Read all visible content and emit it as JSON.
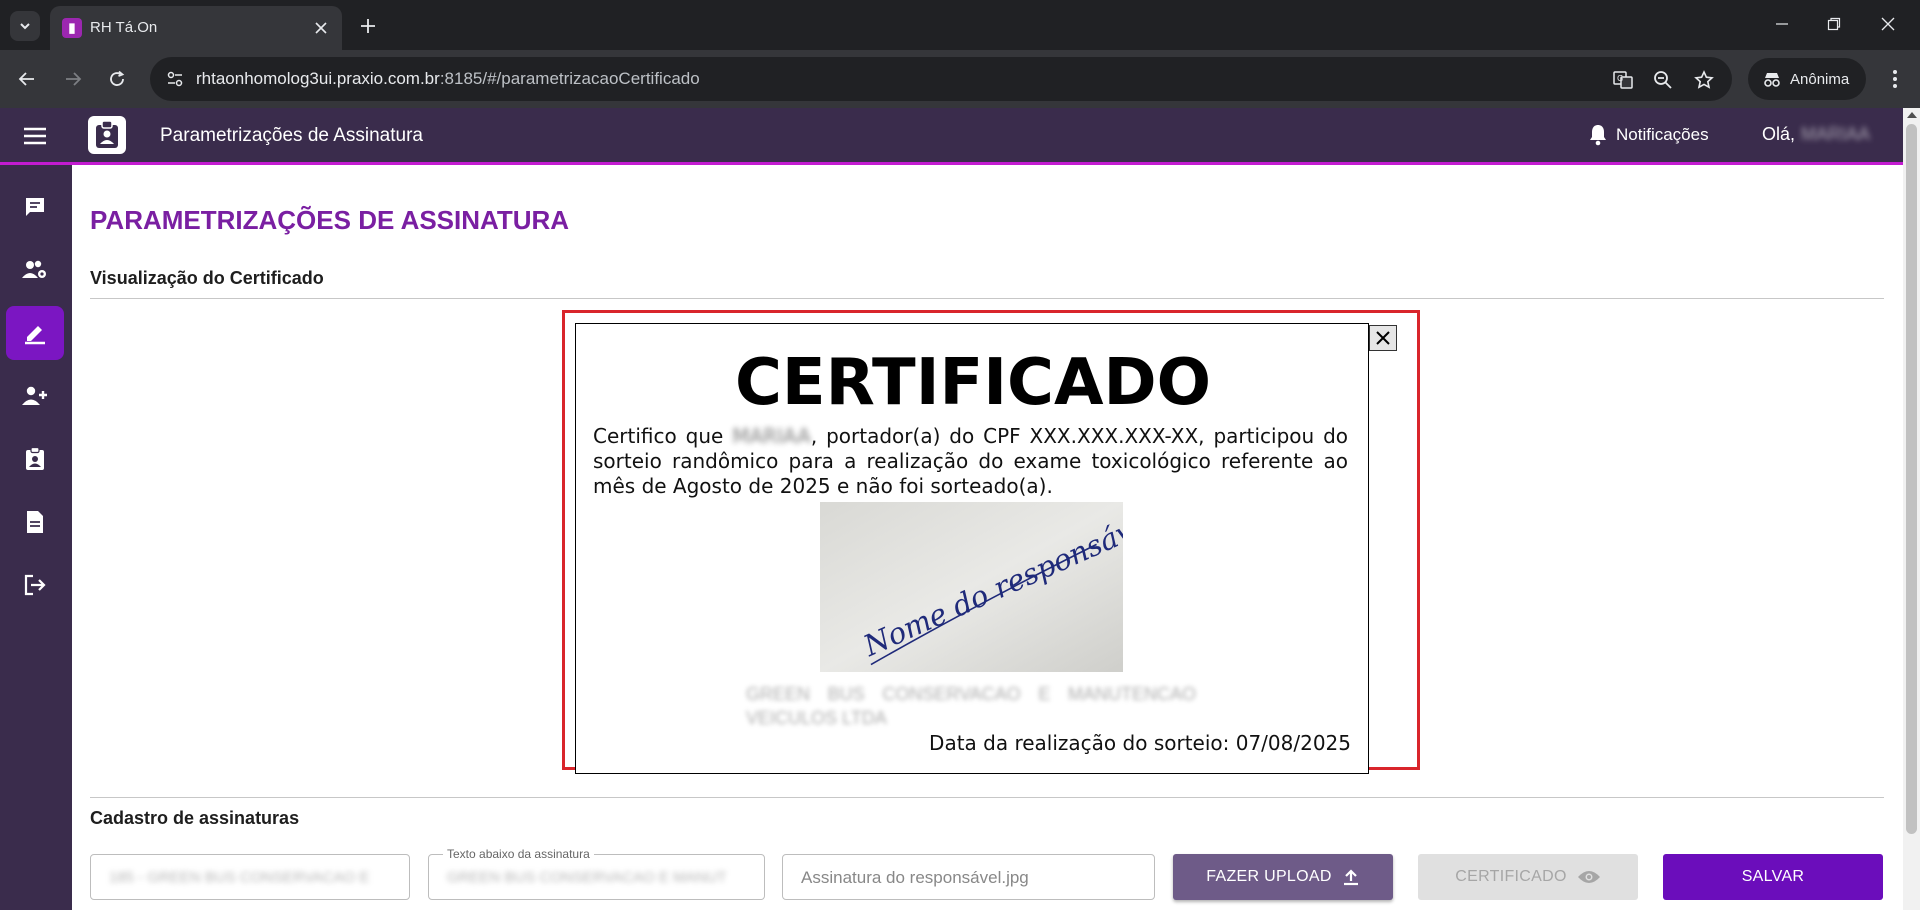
{
  "browser": {
    "tab_title": "RH Tá.On",
    "url_host": "rhtaonhomolog3ui.praxio.com.br",
    "url_rest": ":8185/#/parametrizacaoCertificado",
    "profile_label": "Anônima"
  },
  "header": {
    "app_title": "Parametrizações de Assinatura",
    "notifications_label": "Notificações",
    "greeting": "Olá,",
    "user_name": "MARIAA"
  },
  "sidebar": {
    "items": [
      {
        "icon": "chat-icon"
      },
      {
        "icon": "users-settings-icon"
      },
      {
        "icon": "edit-pen-icon",
        "active": true
      },
      {
        "icon": "add-user-icon"
      },
      {
        "icon": "clipboard-badge-icon"
      },
      {
        "icon": "document-icon"
      },
      {
        "icon": "logout-icon"
      }
    ]
  },
  "page": {
    "title": "PARAMETRIZAÇÕES DE ASSINATURA",
    "preview_section": "Visualização do Certificado",
    "register_section": "Cadastro de assinaturas"
  },
  "certificate": {
    "title": "CERTIFICADO",
    "text_before_name": "Certifico que",
    "name": "MARIAA",
    "text_after_name": ", portador(a) do CPF XXX.XXX.XXX-XX, participou do sorteio randômico para a realização do exame toxicológico referente ao mês de Agosto de 2025 e não foi sorteado(a).",
    "signature_text": "Nome do responsável",
    "company_lines": "GREEN BUS CONSERVACAO E MANUTENCAO VEICULOS LTDA",
    "date_text": "Data da realização do sorteio: 07/08/2025"
  },
  "form": {
    "company_value": "185 - GREEN BUS CONSERVACAO E",
    "text_below_label": "Texto abaixo da assinatura",
    "text_below_value": "GREEN BUS CONSERVACAO E MANUT",
    "signature_file_placeholder": "Assinatura do responsável.jpg",
    "upload_button": "FAZER UPLOAD",
    "certificate_button": "CERTIFICADO",
    "save_button": "SALVAR"
  },
  "colors": {
    "header_bg": "#3a2c4c",
    "accent_purple": "#7a1fa2",
    "save_button": "#6b0dbb",
    "highlight_red": "#d9252b"
  }
}
